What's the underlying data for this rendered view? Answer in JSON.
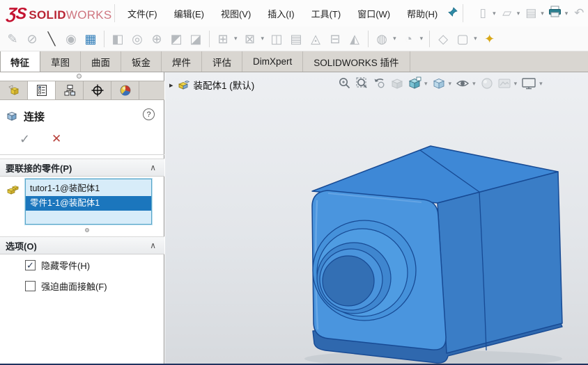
{
  "brand": {
    "logo_mark": "ƷS",
    "logo_bold": "SOLID",
    "logo_light": "WORKS"
  },
  "menubar": {
    "items": [
      "文件(F)",
      "编辑(E)",
      "视图(V)",
      "插入(I)",
      "工具(T)",
      "窗口(W)",
      "帮助(H)"
    ]
  },
  "quick_toolbar": {
    "icons": [
      {
        "name": "new-document",
        "glyph": "▯"
      },
      {
        "name": "open",
        "glyph": "▱"
      },
      {
        "name": "save",
        "glyph": "▤"
      },
      {
        "name": "print",
        "glyph": ""
      },
      {
        "name": "undo",
        "glyph": "↶"
      }
    ]
  },
  "ribbon": {
    "tabs": [
      "特征",
      "草图",
      "曲面",
      "钣金",
      "焊件",
      "评估",
      "DimXpert",
      "SOLIDWORKS 插件"
    ],
    "active_index": 0
  },
  "assembly_toolbar": {
    "icons": [
      {
        "name": "edit-component",
        "glyph": "✎"
      },
      {
        "name": "no-external-references",
        "glyph": "⊘"
      },
      {
        "name": "line-sketch",
        "glyph": "╲"
      },
      {
        "name": "show-hidden-components",
        "glyph": "◉"
      },
      {
        "name": "select-window",
        "glyph": "▦"
      },
      {
        "name": "insert-components",
        "glyph": "◧"
      },
      {
        "name": "mate",
        "glyph": "◎"
      },
      {
        "name": "smart-fasteners",
        "glyph": "⊕"
      },
      {
        "name": "move-component",
        "glyph": "◩"
      },
      {
        "name": "rotate-component",
        "glyph": "◪"
      },
      {
        "name": "assembly-features",
        "glyph": "⊞"
      },
      {
        "name": "linear-component-pattern",
        "glyph": "⊠"
      },
      {
        "name": "mirror-components",
        "glyph": "◫"
      },
      {
        "name": "bill-of-materials",
        "glyph": "▤"
      },
      {
        "name": "exploded-view",
        "glyph": "◬"
      },
      {
        "name": "interference-detection",
        "glyph": "⊟"
      },
      {
        "name": "clearance-verification",
        "glyph": "◭"
      },
      {
        "name": "hide-show-components",
        "glyph": "◍"
      },
      {
        "name": "change-transparency",
        "glyph": "◔"
      },
      {
        "name": "assembly-visualization",
        "glyph": "◇"
      },
      {
        "name": "instant3d",
        "glyph": "▢"
      },
      {
        "name": "toolbox",
        "glyph": "✦"
      }
    ]
  },
  "property_panel": {
    "title": "连接",
    "help_glyph": "?",
    "ok_glyph": "✓",
    "cancel_glyph": "✕",
    "parts_section": {
      "title": "要联接的零件(P)",
      "collapse_glyph": "∧",
      "items": [
        "tutor1-1@装配体1",
        "零件1-1@装配体1"
      ],
      "selected_index": 1
    },
    "options_section": {
      "title": "选项(O)",
      "collapse_glyph": "∧",
      "checkboxes": [
        {
          "label": "隐藏零件(H)",
          "checked": true,
          "glyph": "✓"
        },
        {
          "label": "强迫曲面接触(F)",
          "checked": false,
          "glyph": ""
        }
      ]
    }
  },
  "viewport": {
    "expand_glyph": "▸",
    "tree_item": "装配体1 (默认)"
  },
  "ui": {
    "dropdown_glyph": "▾"
  },
  "colors": {
    "logo_red": "#c41230",
    "model_blue": "#4a95de",
    "model_edge": "#174a94",
    "selection_blue": "#1b76bd",
    "listbox_blue": "#d7ecf9",
    "tab_gray": "#d9d6d1"
  }
}
